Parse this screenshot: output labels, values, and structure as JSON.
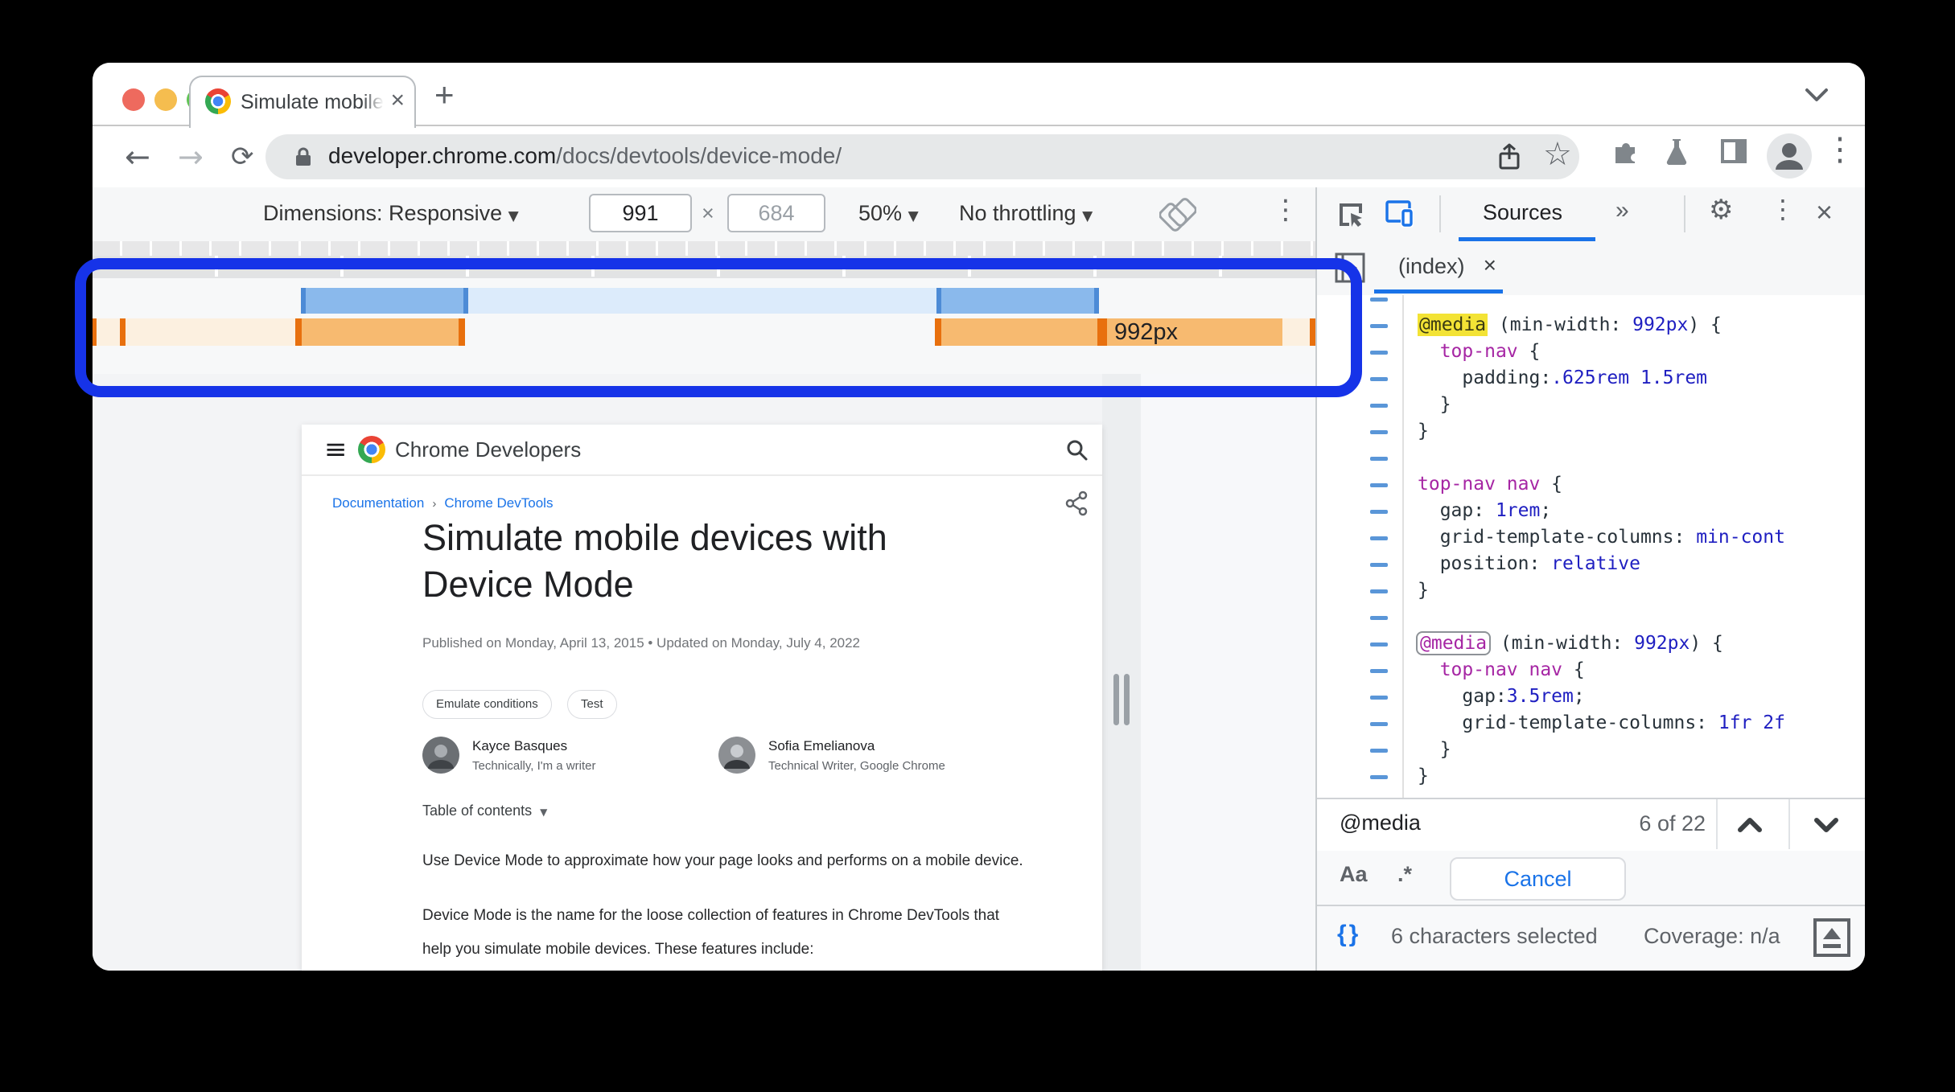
{
  "browser": {
    "tab_title": "Simulate mobile devices with D",
    "url_domain": "developer.chrome.com",
    "url_path": "/docs/devtools/device-mode/"
  },
  "device_toolbar": {
    "dimensions_label": "Dimensions: Responsive",
    "width_value": "991",
    "dim_separator": "×",
    "height_value": "684",
    "zoom_value": "50%",
    "throttling_value": "No throttling"
  },
  "media_bar": {
    "breakpoint_label": "992px"
  },
  "page": {
    "site_name": "Chrome Developers",
    "breadcrumb": [
      "Documentation",
      "Chrome DevTools"
    ],
    "title": "Simulate mobile devices with Device Mode",
    "published_line": "Published on Monday, April 13, 2015 • Updated on Monday, July 4, 2022",
    "chips": [
      "Emulate conditions",
      "Test"
    ],
    "authors": [
      {
        "name": "Kayce Basques",
        "role": "Technically, I'm a writer"
      },
      {
        "name": "Sofia Emelianova",
        "role": "Technical Writer, Google Chrome"
      }
    ],
    "toc_label": "Table of contents",
    "paragraphs": [
      "Use Device Mode to approximate how your page looks and performs on a mobile device.",
      "Device Mode is the name for the loose collection of features in Chrome DevTools that help you simulate mobile devices. These features include:"
    ]
  },
  "devtools": {
    "panel_tab": "Sources",
    "more_tabs": "»",
    "file_tab": "(index)",
    "file_tab_close": "×",
    "code_lines": [
      [],
      [
        [
          "hy",
          "@media"
        ],
        [
          "p",
          " (min-width: "
        ],
        [
          "v",
          "992px"
        ],
        [
          "p",
          ") {"
        ]
      ],
      [
        [
          "p",
          "  "
        ],
        [
          "s",
          "top-nav"
        ],
        [
          "p",
          " {"
        ]
      ],
      [
        [
          "p",
          "    padding:"
        ],
        [
          "v",
          ".625rem 1.5rem"
        ]
      ],
      [
        [
          "p",
          "  }"
        ]
      ],
      [
        [
          "p",
          "}"
        ]
      ],
      [],
      [
        [
          "s",
          "top-nav nav"
        ],
        [
          "p",
          " {"
        ]
      ],
      [
        [
          "p",
          "  gap: "
        ],
        [
          "v",
          "1rem"
        ],
        [
          "p",
          ";"
        ]
      ],
      [
        [
          "p",
          "  grid-template-columns: "
        ],
        [
          "v",
          "min-cont"
        ]
      ],
      [
        [
          "p",
          "  position: "
        ],
        [
          "v",
          "relative"
        ]
      ],
      [
        [
          "p",
          "}"
        ]
      ],
      [],
      [
        [
          "ho",
          "@media"
        ],
        [
          "p",
          " (min-width: "
        ],
        [
          "v",
          "992px"
        ],
        [
          "p",
          ") {"
        ]
      ],
      [
        [
          "p",
          "  "
        ],
        [
          "s",
          "top-nav nav"
        ],
        [
          "p",
          " {"
        ]
      ],
      [
        [
          "p",
          "    gap:"
        ],
        [
          "v",
          "3.5rem"
        ],
        [
          "p",
          ";"
        ]
      ],
      [
        [
          "p",
          "    grid-template-columns: "
        ],
        [
          "v",
          "1fr 2f"
        ]
      ],
      [
        [
          "p",
          "  }"
        ]
      ],
      [
        [
          "p",
          "}"
        ]
      ]
    ],
    "search": {
      "query": "@media",
      "match_count": "6 of 22",
      "case_toggle": "Aa",
      "regex_toggle": ".*",
      "cancel_label": "Cancel"
    },
    "status": {
      "pretty_print": "{}",
      "selection": "6 characters selected",
      "coverage": "Coverage: n/a"
    }
  },
  "icons": {
    "back": "←",
    "forward": "→",
    "reload": "⟳",
    "star": "☆",
    "kebab": "⋮",
    "hamburger": "≡",
    "gear": "⚙",
    "new_tab": "+",
    "tab_close": "×",
    "panel_close": "×",
    "dropdown_caret": "▼"
  },
  "colors": {
    "accent_blue": "#1a73e8",
    "annotation_blue": "#1633e8",
    "breakpoint_orange_fill": "#f7ba70",
    "breakpoint_orange_tick": "#e8700e",
    "breakpoint_blue_fill": "#8ab9ec",
    "breakpoint_blue_light": "#dcebfb",
    "search_highlight_yellow": "#f3e335",
    "css_value_blue": "#1f1fc1",
    "css_selector_purple": "#a626a4"
  }
}
